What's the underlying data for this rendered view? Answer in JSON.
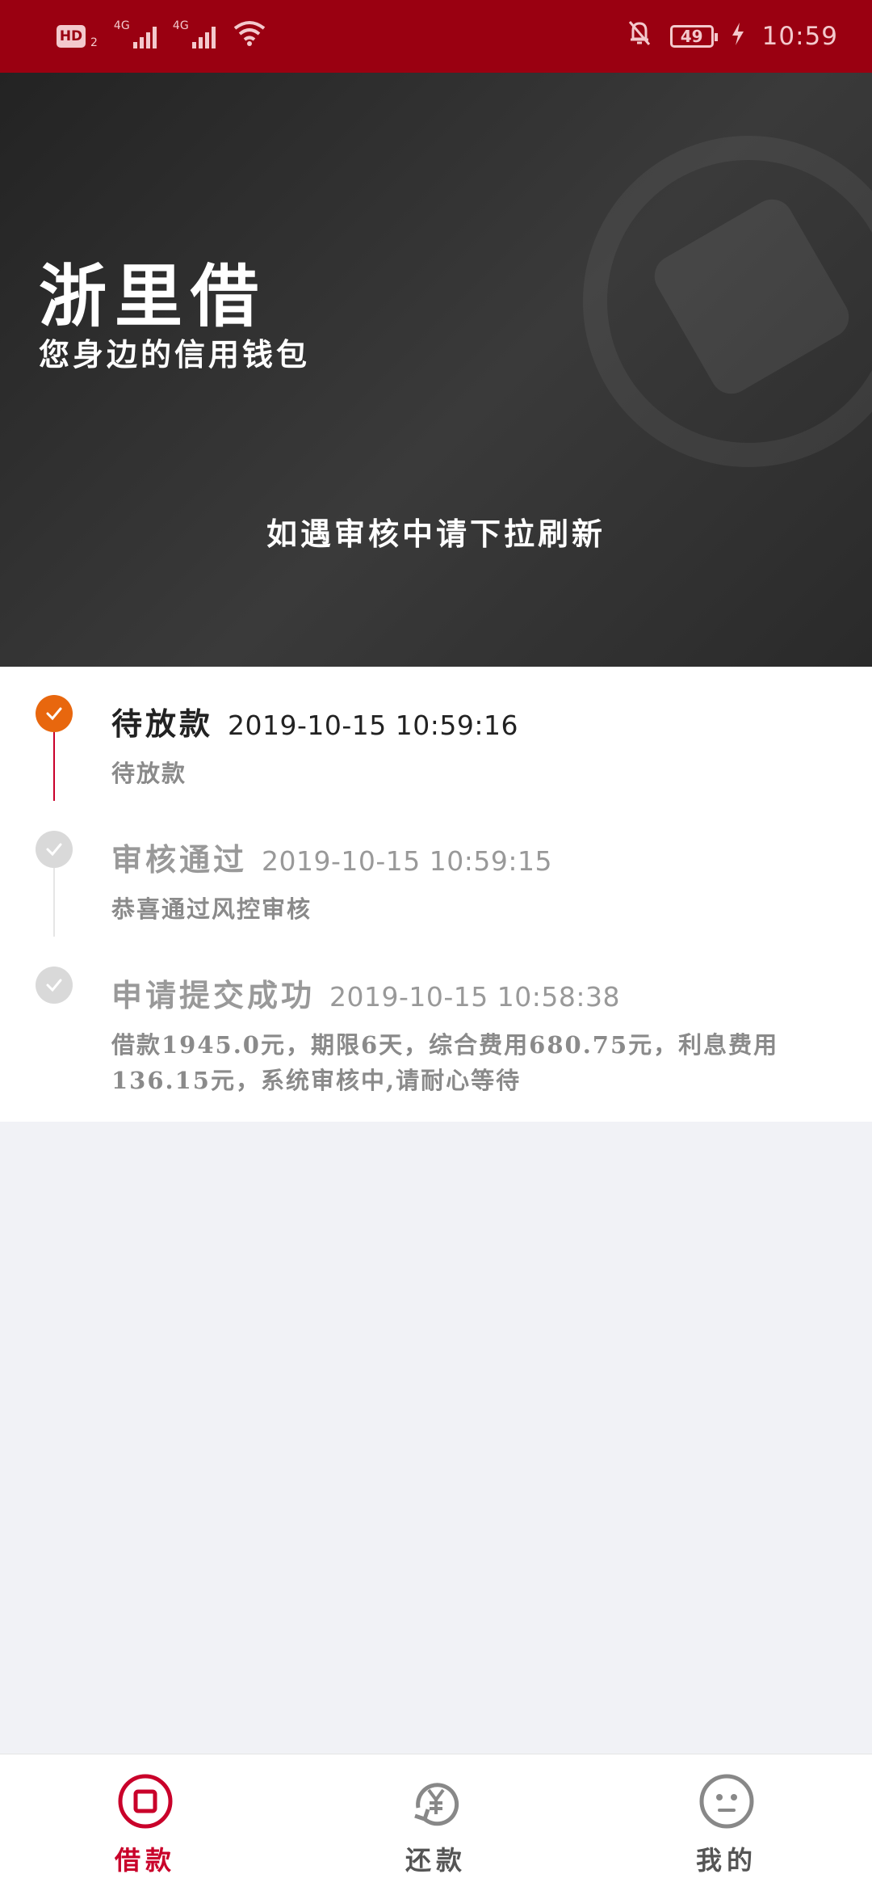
{
  "status_bar": {
    "hd": "HD",
    "sim": "2",
    "network1": "4G",
    "network2": "4G",
    "battery": "49",
    "time": "10:59"
  },
  "hero": {
    "app_name": "浙里借",
    "slogan": "您身边的信用钱包",
    "refresh_hint": "如遇审核中请下拉刷新"
  },
  "timeline": [
    {
      "name": "待放款",
      "time": "2019-10-15 10:59:16",
      "desc": "待放款",
      "state": "active"
    },
    {
      "name": "审核通过",
      "time": "2019-10-15 10:59:15",
      "desc": "恭喜通过风控审核",
      "state": "done"
    },
    {
      "name": "申请提交成功",
      "time": "2019-10-15 10:58:38",
      "desc": "借款1945.0元，期限6天，综合费用680.75元，利息费用136.15元，系统审核中,请耐心等待",
      "state": "done"
    }
  ],
  "nav": {
    "items": [
      {
        "label": "借款",
        "icon": "borrow-icon",
        "active": true
      },
      {
        "label": "还款",
        "icon": "repay-yuan-icon",
        "active": false
      },
      {
        "label": "我的",
        "icon": "profile-face-icon",
        "active": false
      }
    ]
  },
  "colors": {
    "status_bar": "#9a0011",
    "accent_red": "#c9002a",
    "active_dot": "#e8670e",
    "done_dot": "#d9d9d9"
  }
}
